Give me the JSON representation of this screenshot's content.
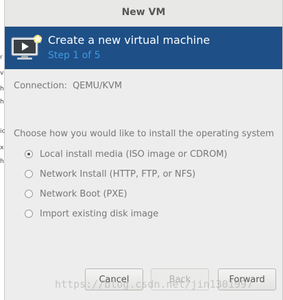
{
  "window": {
    "title": "New VM"
  },
  "banner": {
    "title": "Create a new virtual machine",
    "step": "Step 1 of 5",
    "icon": "virtual-machine-new-icon"
  },
  "connection": {
    "label": "Connection:",
    "value": "QEMU/KVM"
  },
  "install": {
    "question": "Choose how you would like to install the operating system",
    "options": [
      {
        "label": "Local install media (ISO image or CDROM)",
        "selected": true
      },
      {
        "label": "Network Install (HTTP, FTP, or NFS)",
        "selected": false
      },
      {
        "label": "Network Boot (PXE)",
        "selected": false
      },
      {
        "label": "Import existing disk image",
        "selected": false
      }
    ]
  },
  "buttons": {
    "cancel": "Cancel",
    "back": "Back",
    "forward": "Forward"
  },
  "watermark": "https://blog.csdn.net/jin1301997",
  "left_strip_glyphs": [
    "r",
    "v",
    "h",
    "h",
    "ic",
    "x",
    "h"
  ],
  "colors": {
    "banner_bg": "#1e4f86",
    "step_text": "#3f9ae2"
  }
}
